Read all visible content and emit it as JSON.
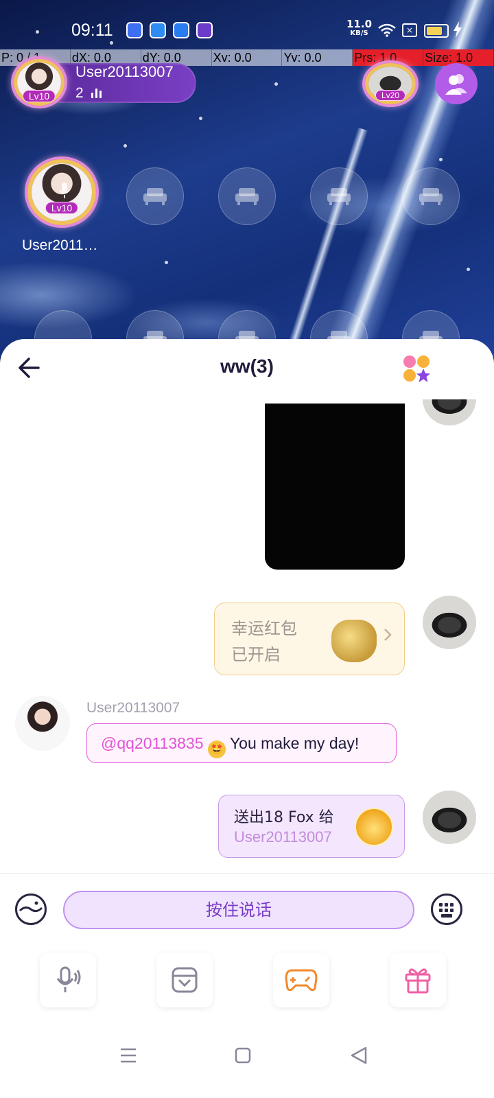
{
  "status_bar": {
    "time": "09:11",
    "net_speed": "11.0",
    "net_unit": "KB/S",
    "sim_label": "×",
    "icons": [
      "baidu-app-icon",
      "play-app-icon",
      "qq-browser-icon",
      "purple-app-icon",
      "wifi-icon",
      "sim-icon",
      "battery-icon",
      "charging-icon"
    ]
  },
  "debug": {
    "pointer": "P: 0 / 1",
    "dx": "dX: 0.0",
    "dy": "dY: 0.0",
    "xv": "Xv: 0.0",
    "yv": "Yv: 0.0",
    "prs": "Prs: 1.0",
    "size": "Size: 1.0"
  },
  "room": {
    "host_name": "User20113007",
    "host_level": "Lv10",
    "online_count": "2",
    "right_level": "Lv20",
    "seat_user_name": "User2011…",
    "seat_user_level": "Lv10"
  },
  "chat": {
    "title": "ww(3)",
    "red_packet_line1": "幸运红包",
    "red_packet_line2": "已开启",
    "message_username": "User20113007",
    "mention": "@qq20113835",
    "message_emoji": "🤩",
    "message_text": "You make my day!",
    "gift_line1": "送出18 Fox 给",
    "gift_line2": "User20113007"
  },
  "input": {
    "voice_button_label": "按住说话"
  },
  "colors": {
    "accent_purple": "#7b3bc5",
    "mention_pink": "#e154d6",
    "members_button": "#b25ce8"
  }
}
